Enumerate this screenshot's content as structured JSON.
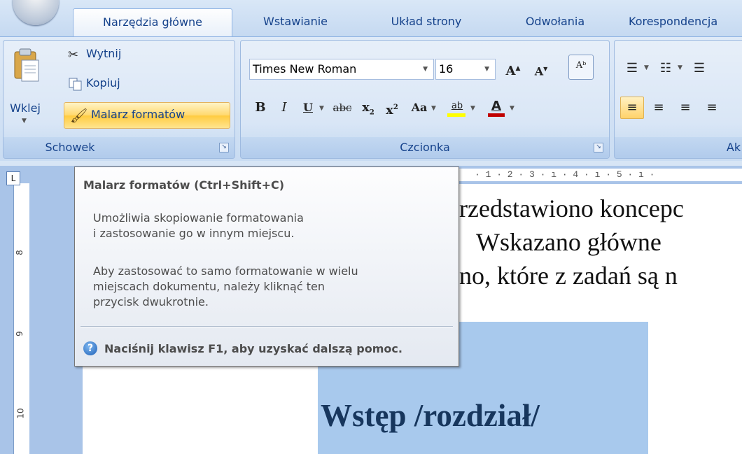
{
  "tabs": [
    "Narzędzia główne",
    "Wstawianie",
    "Układ strony",
    "Odwołania",
    "Korespondencja"
  ],
  "clipboard": {
    "paste": "Wklej",
    "cut": "Wytnij",
    "copy": "Kopiuj",
    "format_painter": "Malarz formatów",
    "group_label": "Schowek"
  },
  "font": {
    "name": "Times New Roman",
    "size": "16",
    "group_label": "Czcionka"
  },
  "paragraph": {
    "group_label_partial": "Ak"
  },
  "ruler": {
    "ticks": "· 1 · 2 · 3 · ı · 4 · ı · 5 · ı ·",
    "vertical_numbers": [
      "8",
      "9",
      "10"
    ]
  },
  "document": {
    "line1": "rzedstawiono koncepc",
    "line2": "Wskazano  główne",
    "line3": "no, które z zadań są n",
    "heading": "Wstęp /rozdział/"
  },
  "tooltip": {
    "title": "Malarz formatów (Ctrl+Shift+C)",
    "body1_line1": "Umożliwia skopiowanie formatowania",
    "body1_line2": "i zastosowanie go w innym miejscu.",
    "body2_line1": "Aby zastosować to samo formatowanie w wielu",
    "body2_line2": "miejscach dokumentu, należy kliknąć ten",
    "body2_line3": "przycisk dwukrotnie.",
    "help": "Naciśnij klawisz F1, aby uzyskać dalszą pomoc."
  },
  "colors": {
    "tab_text": "#15428b",
    "highlight_yellow": "#ffff00",
    "font_color_red": "#c00000",
    "title_box": "#a8c9ed"
  }
}
